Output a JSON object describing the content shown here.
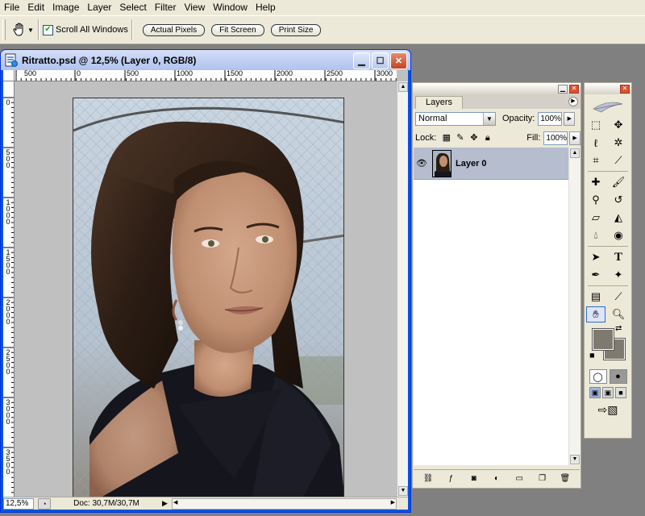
{
  "menubar": {
    "items": [
      "File",
      "Edit",
      "Image",
      "Layer",
      "Select",
      "Filter",
      "View",
      "Window",
      "Help"
    ]
  },
  "options": {
    "scroll_all_label": "Scroll All Windows",
    "scroll_all_checked": true,
    "actual_pixels": "Actual Pixels",
    "fit_screen": "Fit Screen",
    "print_size": "Print Size"
  },
  "document": {
    "title": "Ritratto.psd @ 12,5% (Layer 0, RGB/8)",
    "hruler_labels": [
      "500",
      "0",
      "500",
      "1000",
      "1500",
      "2000",
      "2500",
      "3000"
    ],
    "vruler_labels": [
      "0",
      "500",
      "1000",
      "1500",
      "2000",
      "2500",
      "3000",
      "3500"
    ],
    "zoom": "12,5%",
    "doc_info": "Doc: 30,7M/30,7M"
  },
  "layers_panel": {
    "tab_label": "Layers",
    "blend_mode": "Normal",
    "opacity_label": "Opacity:",
    "opacity_value": "100%",
    "lock_label": "Lock:",
    "fill_label": "Fill:",
    "fill_value": "100%",
    "layers": [
      {
        "name": "Layer 0",
        "visible": true,
        "selected": true
      }
    ]
  },
  "toolbox": {
    "foreground_color": "#7e7a6f",
    "background_color": "#7e7a6f"
  },
  "colors": {
    "xp_blue": "#0054e3",
    "chrome": "#ece9d8",
    "workspace": "#808080",
    "selected_layer": "#b5bdcf"
  }
}
